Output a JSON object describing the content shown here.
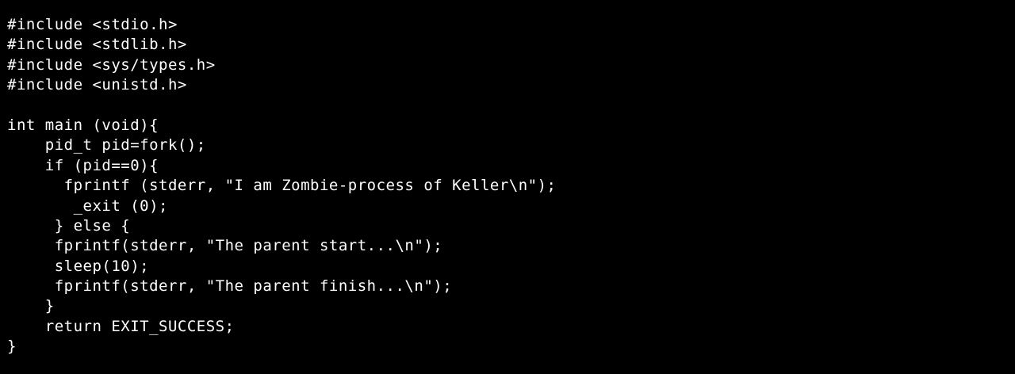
{
  "terminal": {
    "lines": [
      "#include <stdio.h>",
      "#include <stdlib.h>",
      "#include <sys/types.h>",
      "#include <unistd.h>",
      "",
      "int main (void){",
      "    pid_t pid=fork();",
      "    if (pid==0){",
      "      fprintf (stderr, \"I am Zombie-process of Keller\\n\");",
      "       _exit (0);",
      "     } else {",
      "     fprintf(stderr, \"The parent start...\\n\");",
      "     sleep(10);",
      "     fprintf(stderr, \"The parent finish...\\n\");",
      "    }",
      "    return EXIT_SUCCESS;",
      "}"
    ]
  }
}
